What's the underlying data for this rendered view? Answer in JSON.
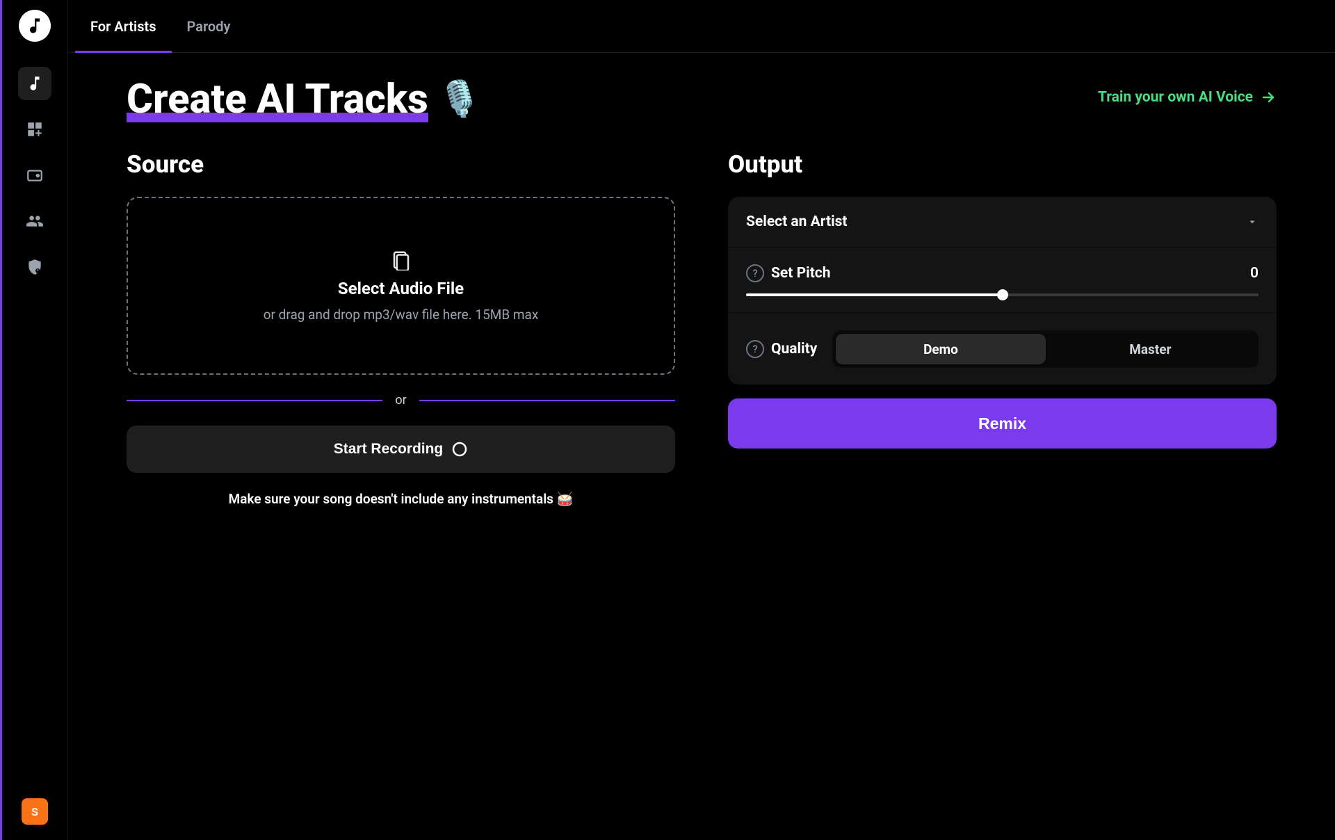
{
  "accent_color": "#7c3aed",
  "sidebar": {
    "avatar_letter": "S"
  },
  "topbar": {
    "tabs": [
      {
        "label": "For Artists",
        "active": true
      },
      {
        "label": "Parody",
        "active": false
      }
    ]
  },
  "header": {
    "title": "Create AI Tracks",
    "emoji": "🎙️",
    "train_link": "Train your own AI Voice"
  },
  "source": {
    "title": "Source",
    "dropzone_title": "Select Audio File",
    "dropzone_sub": "or drag and drop mp3/wav file here. 15MB max",
    "divider": "or",
    "record_button": "Start Recording",
    "hint": "Make sure your song doesn't include any instrumentals 🥁"
  },
  "output": {
    "title": "Output",
    "select_placeholder": "Select an Artist",
    "pitch_label": "Set Pitch",
    "pitch_value": "0",
    "quality_label": "Quality",
    "quality_options": [
      "Demo",
      "Master"
    ],
    "quality_selected": "Demo",
    "remix_button": "Remix"
  }
}
